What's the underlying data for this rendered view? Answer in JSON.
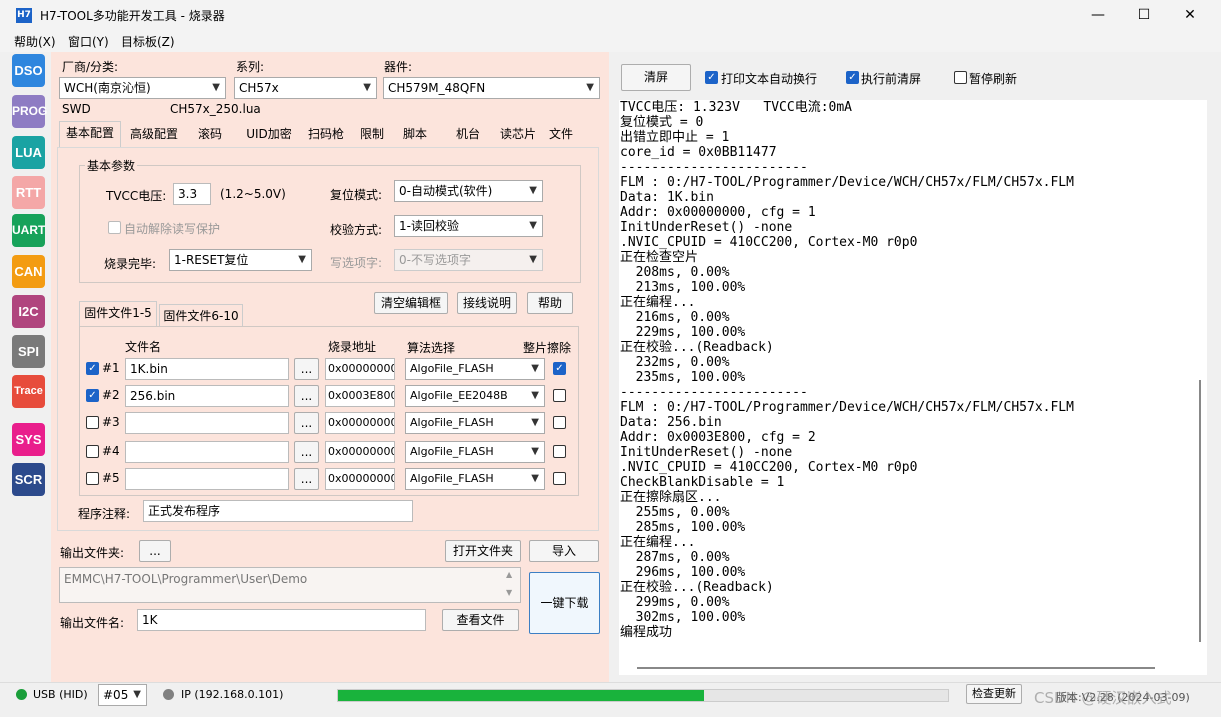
{
  "window": {
    "title": "H7-TOOL多功能开发工具 - 烧录器",
    "icon_text": "H7",
    "minimize": "—",
    "maximize": "☐",
    "close": "✕"
  },
  "menu": [
    "帮助(X)",
    "窗口(Y)",
    "目标板(Z)"
  ],
  "sidebar": [
    {
      "label": "DSO",
      "color": "#2e86de"
    },
    {
      "label": "PROG",
      "color": "#8e7cc3"
    },
    {
      "label": "LUA",
      "color": "#1aa3a3"
    },
    {
      "label": "RTT",
      "color": "#f4a7a7"
    },
    {
      "label": "UART",
      "color": "#17a25a"
    },
    {
      "label": "CAN",
      "color": "#f39c12"
    },
    {
      "label": "I2C",
      "color": "#b0457e"
    },
    {
      "label": "SPI",
      "color": "#7a7a7a"
    },
    {
      "label": "Trace",
      "color": "#e74c3c"
    },
    {
      "label": "SYS",
      "color": "#e91e8c"
    },
    {
      "label": "SCR",
      "color": "#2c4a8c"
    }
  ],
  "selectors": {
    "vendor_label": "厂商/分类:",
    "vendor_value": "WCH(南京沁恒)",
    "series_label": "系列:",
    "series_value": "CH57x",
    "device_label": "器件:",
    "device_value": "CH579M_48QFN",
    "interface": "SWD",
    "lua_file": "CH57x_250.lua"
  },
  "tabs": [
    "基本配置",
    "高级配置",
    "滚码",
    "UID加密",
    "扫码枪",
    "限制",
    "脚本",
    "机台",
    "读芯片",
    "文件"
  ],
  "basic": {
    "group_title": "基本参数",
    "tvcc_label": "TVCC电压:",
    "tvcc_value": "3.3",
    "tvcc_range": "(1.2~5.0V)",
    "reset_label": "复位模式:",
    "reset_value": "0-自动模式(软件)",
    "unprotect_label": "自动解除读写保护",
    "verify_label": "校验方式:",
    "verify_value": "1-读回校验",
    "finish_label": "烧录完毕:",
    "finish_value": "1-RESET复位",
    "option_label": "写选项字:",
    "option_value": "0-不写选项字"
  },
  "buttons": {
    "clear_editor": "清空编辑框",
    "wiring": "接线说明",
    "help": "帮助",
    "dots": "...",
    "open_folder": "打开文件夹",
    "import": "导入",
    "view_file": "查看文件",
    "one_click": "一键下载",
    "clear": "清屏",
    "check_update": "检查更新"
  },
  "file_tabs": [
    "固件文件1-5",
    "固件文件6-10"
  ],
  "file_headers": {
    "name": "文件名",
    "addr": "烧录地址",
    "algo": "算法选择",
    "erase": "整片擦除"
  },
  "files": [
    {
      "idx": "#1",
      "checked": true,
      "name": "1K.bin",
      "addr": "0x00000000",
      "algo": "AlgoFile_FLASH",
      "erase": true
    },
    {
      "idx": "#2",
      "checked": true,
      "name": "256.bin",
      "addr": "0x0003E800",
      "algo": "AlgoFile_EE2048B",
      "erase": false
    },
    {
      "idx": "#3",
      "checked": false,
      "name": "",
      "addr": "0x00000000",
      "algo": "AlgoFile_FLASH",
      "erase": false
    },
    {
      "idx": "#4",
      "checked": false,
      "name": "",
      "addr": "0x00000000",
      "algo": "AlgoFile_FLASH",
      "erase": false
    },
    {
      "idx": "#5",
      "checked": false,
      "name": "",
      "addr": "0x00000000",
      "algo": "AlgoFile_FLASH",
      "erase": false
    }
  ],
  "note": {
    "label": "程序注释:",
    "value": "正式发布程序"
  },
  "output": {
    "folder_label": "输出文件夹:",
    "path": "EMMC\\H7-TOOL\\Programmer\\User\\Demo",
    "name_label": "输出文件名:",
    "name_value": "1K"
  },
  "console_opts": {
    "wrap": "打印文本自动换行",
    "clear_before": "执行前清屏",
    "pause": "暂停刷新"
  },
  "console_lines": [
    "TVCC电压: 1.323V   TVCC电流:0mA",
    "复位模式 = 0",
    "出错立即中止 = 1",
    "core_id = 0x0BB11477",
    "------------------------",
    "FLM : 0:/H7-TOOL/Programmer/Device/WCH/CH57x/FLM/CH57x.FLM",
    "Data: 1K.bin",
    "Addr: 0x00000000, cfg = 1",
    "InitUnderReset() -none",
    ".NVIC_CPUID = 410CC200, Cortex-M0 r0p0",
    "正在检查空片",
    "  208ms, 0.00%",
    "  213ms, 100.00%",
    "正在编程...",
    "  216ms, 0.00%",
    "  229ms, 100.00%",
    "正在校验...(Readback)",
    "  232ms, 0.00%",
    "  235ms, 100.00%",
    "------------------------",
    "FLM : 0:/H7-TOOL/Programmer/Device/WCH/CH57x/FLM/CH57x.FLM",
    "Data: 256.bin",
    "Addr: 0x0003E800, cfg = 2",
    "InitUnderReset() -none",
    ".NVIC_CPUID = 410CC200, Cortex-M0 r0p0",
    "CheckBlankDisable = 1",
    "正在擦除扇区...",
    "  255ms, 0.00%",
    "  285ms, 100.00%",
    "正在编程...",
    "  287ms, 0.00%",
    "  296ms, 100.00%",
    "正在校验...(Readback)",
    "  299ms, 0.00%",
    "  302ms, 100.00%",
    "编程成功"
  ],
  "status": {
    "usb": "USB (HID)",
    "port": "#05",
    "ip": "IP (192.168.0.101)",
    "progress": 0.6,
    "version": "版本:V2.28 (2024-03-09)",
    "watermark": "CSDN @硬汉嵌入式"
  },
  "colors": {
    "usb_led": "#1a9e3a",
    "ip_led": "#808080",
    "progress": "#19b33c"
  }
}
